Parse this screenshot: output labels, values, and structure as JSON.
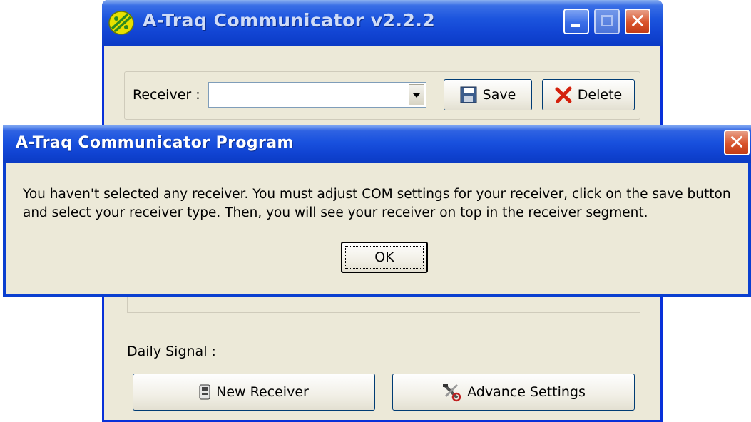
{
  "main_window": {
    "title": "A-Traq Communicator v2.2.2",
    "receiver_label": "Receiver :",
    "receiver_value": "",
    "save_label": "Save",
    "delete_label": "Delete",
    "daily_signal_label": "Daily Signal :",
    "new_receiver_label": "New Receiver",
    "advance_settings_label": "Advance Settings"
  },
  "dialog": {
    "title": "A-Traq Communicator Program",
    "message": "You haven't selected any receiver. You must adjust COM settings for your receiver, click on the save button and select your receiver type. Then, you will see your receiver on top in the receiver segment.",
    "ok_label": "OK"
  },
  "colors": {
    "titlebar_blue": "#1951de",
    "window_face": "#ece9d8",
    "close_red": "#d9542c"
  },
  "icons": [
    "app-icon",
    "minimize-icon",
    "maximize-icon",
    "close-icon",
    "floppy-disk-icon",
    "red-x-icon",
    "device-icon",
    "tools-icon"
  ]
}
